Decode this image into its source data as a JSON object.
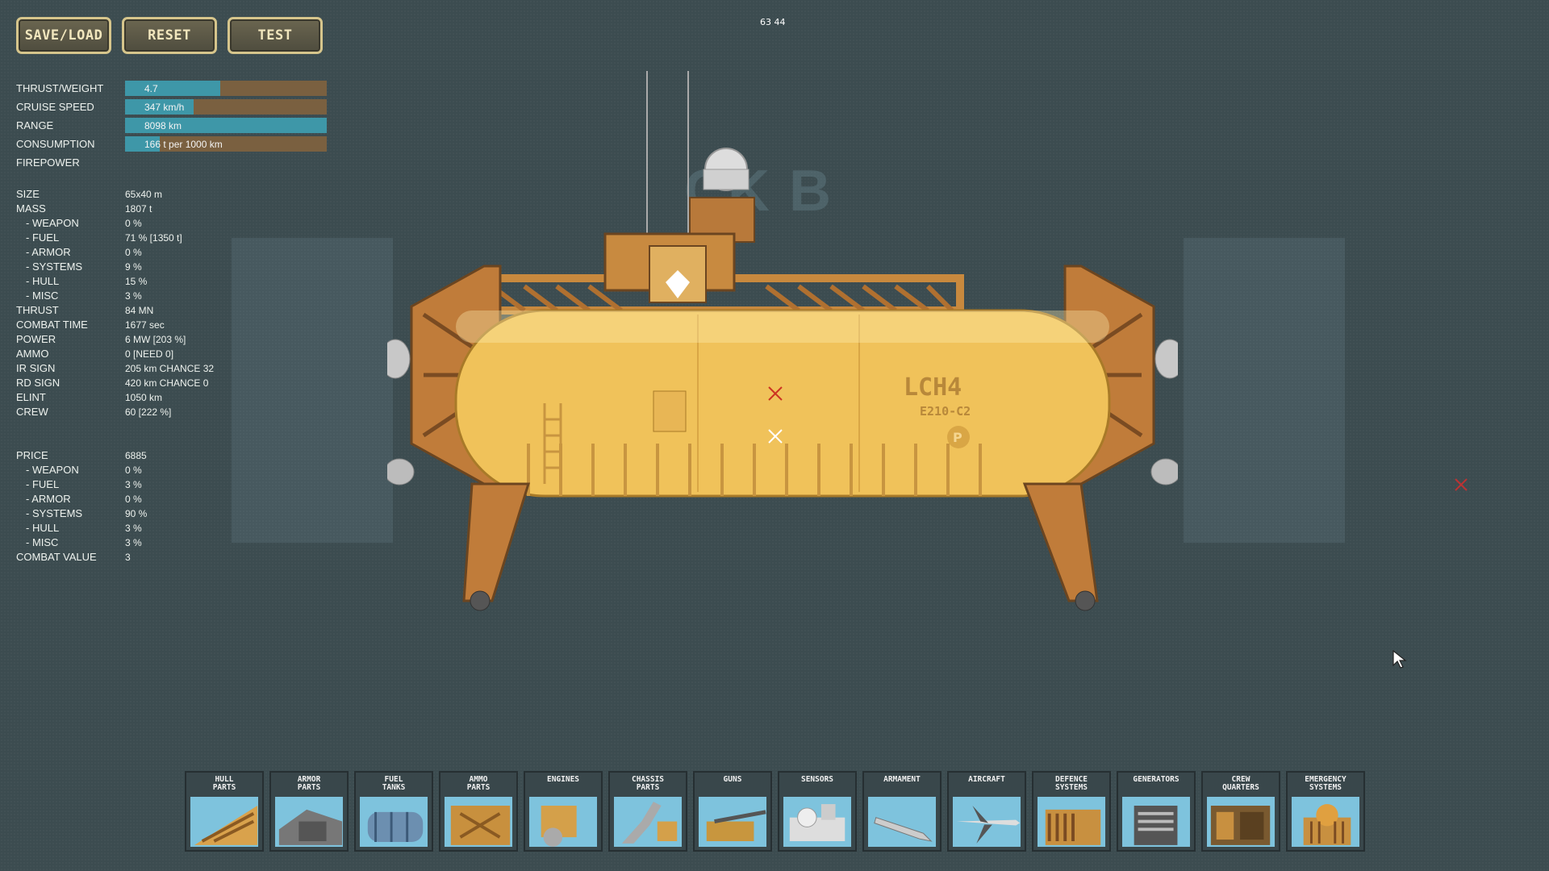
{
  "toolbar": {
    "save_load_label": "SAVE/LOAD",
    "reset_label": "RESET",
    "test_label": "TEST"
  },
  "fps_counter": "63  44",
  "background_title": "CK B",
  "performance": {
    "thrust_weight": {
      "label": "THRUST/WEIGHT",
      "value": "4.7",
      "fill": 0.47
    },
    "cruise_speed": {
      "label": "CRUISE SPEED",
      "value": "347 km/h",
      "fill": 0.34
    },
    "range": {
      "label": "RANGE",
      "value": "8098 km",
      "fill": 1.0
    },
    "consumption": {
      "label": "CONSUMPTION",
      "value": "166 t per 1000 km",
      "fill": 0.17
    },
    "firepower": {
      "label": "FIREPOWER",
      "value": ""
    }
  },
  "stats": {
    "size": {
      "label": "SIZE",
      "value": "65x40 m"
    },
    "mass": {
      "label": "MASS",
      "value": "1807 t"
    },
    "mass_weapon": {
      "label": "- WEAPON",
      "value": "0 %"
    },
    "mass_fuel": {
      "label": "- FUEL",
      "value": "71 % [1350 t]"
    },
    "mass_armor": {
      "label": "- ARMOR",
      "value": "0 %"
    },
    "mass_systems": {
      "label": "- SYSTEMS",
      "value": "9 %"
    },
    "mass_hull": {
      "label": "- HULL",
      "value": "15 %"
    },
    "mass_misc": {
      "label": "- MISC",
      "value": "3 %"
    },
    "thrust": {
      "label": "THRUST",
      "value": "84 MN"
    },
    "combat_time": {
      "label": "COMBAT TIME",
      "value": "1677 sec"
    },
    "power": {
      "label": "POWER",
      "value": "6 MW [203 %]"
    },
    "ammo": {
      "label": "AMMO",
      "value": "0 [NEED 0]"
    },
    "ir_sign": {
      "label": "IR SIGN",
      "value": "205 km CHANCE 32"
    },
    "rd_sign": {
      "label": "RD SIGN",
      "value": "420 km CHANCE 0"
    },
    "elint": {
      "label": "ELINT",
      "value": "1050 km"
    },
    "crew": {
      "label": "CREW",
      "value": "60 [222 %]"
    }
  },
  "price": {
    "price": {
      "label": "PRICE",
      "value": "6885"
    },
    "price_weapon": {
      "label": "- WEAPON",
      "value": "0 %"
    },
    "price_fuel": {
      "label": "- FUEL",
      "value": "3 %"
    },
    "price_armor": {
      "label": "- ARMOR",
      "value": "0 %"
    },
    "price_systems": {
      "label": "- SYSTEMS",
      "value": "90 %"
    },
    "price_hull": {
      "label": "- HULL",
      "value": "3 %"
    },
    "price_misc": {
      "label": "- MISC",
      "value": "3 %"
    },
    "combat_value": {
      "label": "COMBAT VALUE",
      "value": "3"
    }
  },
  "ship_markings": {
    "name": "LCH4",
    "code": "E210-C2",
    "badge": "P"
  },
  "categories": [
    {
      "label": "HULL\nPARTS",
      "icon": "hull-parts-icon"
    },
    {
      "label": "ARMOR\nPARTS",
      "icon": "armor-parts-icon"
    },
    {
      "label": "FUEL\nTANKS",
      "icon": "fuel-tanks-icon"
    },
    {
      "label": "AMMO\nPARTS",
      "icon": "ammo-parts-icon"
    },
    {
      "label": "ENGINES",
      "icon": "engines-icon"
    },
    {
      "label": "CHASSIS\nPARTS",
      "icon": "chassis-parts-icon"
    },
    {
      "label": "GUNS",
      "icon": "guns-icon"
    },
    {
      "label": "SENSORS",
      "icon": "sensors-icon"
    },
    {
      "label": "ARMAMENT",
      "icon": "armament-icon"
    },
    {
      "label": "AIRCRAFT",
      "icon": "aircraft-icon"
    },
    {
      "label": "DEFENCE\nSYSTEMS",
      "icon": "defence-systems-icon"
    },
    {
      "label": "GENERATORS",
      "icon": "generators-icon"
    },
    {
      "label": "CREW\nQUARTERS",
      "icon": "crew-quarters-icon"
    },
    {
      "label": "EMERGENCY\nSYSTEMS",
      "icon": "emergency-systems-icon"
    }
  ],
  "colors": {
    "bar_fill": "#3e97a8",
    "bar_track": "#7a6040",
    "hull": "#f0c25a",
    "frame": "#c8893e",
    "background": "#3c4c50"
  }
}
